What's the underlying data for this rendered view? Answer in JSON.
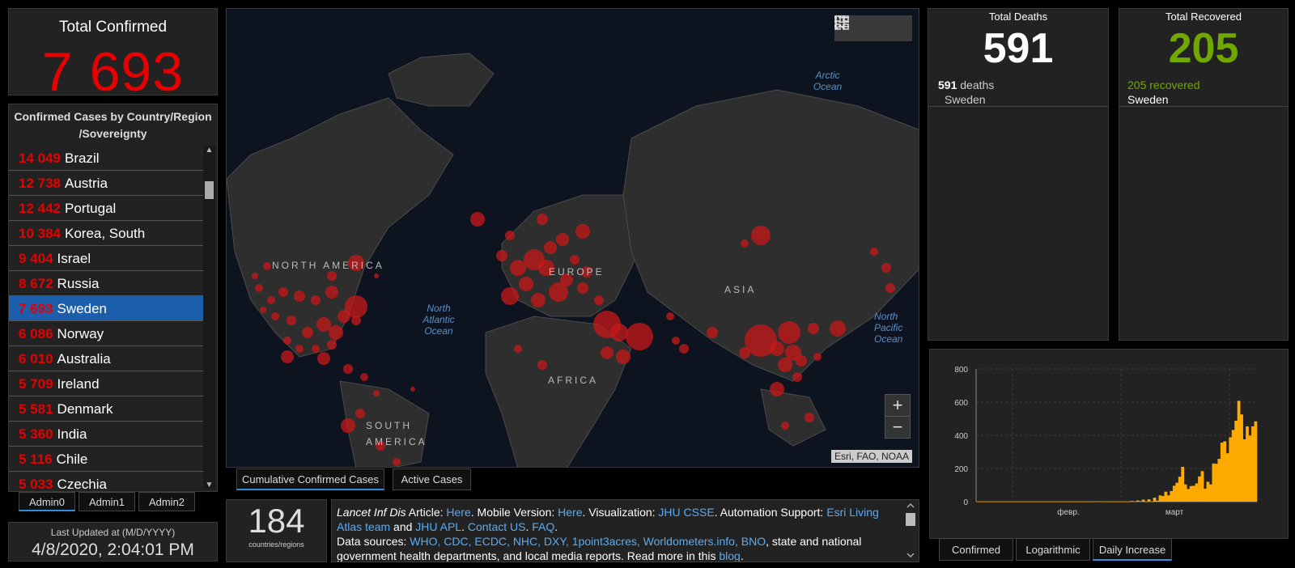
{
  "total_confirmed": {
    "title": "Total Confirmed",
    "value": "7 693"
  },
  "country_list": {
    "header": "Confirmed Cases by Country/Region /Sovereignty",
    "rows": [
      {
        "num": "14 049",
        "name": "Brazil"
      },
      {
        "num": "12 738",
        "name": "Austria"
      },
      {
        "num": "12 442",
        "name": "Portugal"
      },
      {
        "num": "10 384",
        "name": "Korea, South"
      },
      {
        "num": "9 404",
        "name": "Israel"
      },
      {
        "num": "8 672",
        "name": "Russia"
      },
      {
        "num": "7 693",
        "name": "Sweden",
        "selected": true
      },
      {
        "num": "6 086",
        "name": "Norway"
      },
      {
        "num": "6 010",
        "name": "Australia"
      },
      {
        "num": "5 709",
        "name": "Ireland"
      },
      {
        "num": "5 581",
        "name": "Denmark"
      },
      {
        "num": "5 360",
        "name": "India"
      },
      {
        "num": "5 116",
        "name": "Chile"
      },
      {
        "num": "5 033",
        "name": "Czechia"
      }
    ]
  },
  "admin_tabs": [
    "Admin0",
    "Admin1",
    "Admin2"
  ],
  "last_updated": {
    "label": "Last Updated at (M/D/YYYY)",
    "value": "4/8/2020, 2:04:01 PM"
  },
  "map": {
    "labels": {
      "north_america": "NORTH AMERICA",
      "europe": "EUROPE",
      "asia": "ASIA",
      "africa": "AFRICA",
      "south_america": "SOUTH AMERICA",
      "north_atlantic": "North Atlantic Ocean",
      "arctic": "Arctic Ocean",
      "north_pacific": "North Pacific Ocean"
    },
    "attribution": "Esri, FAO, NOAA",
    "zoom_in": "+",
    "zoom_out": "−",
    "tabs": [
      "Cumulative Confirmed Cases",
      "Active Cases"
    ]
  },
  "countries_count": {
    "value": "184",
    "label": "countries/regions"
  },
  "info": {
    "article_journal": "Lancet Inf Dis",
    "article_text": " Article: ",
    "here1": "Here",
    "mobile_text": ". Mobile Version: ",
    "here2": "Here",
    "viz_text": ". Visualization: ",
    "jhu_csse": "JHU CSSE",
    "auto_text": ". Automation Support: ",
    "esri": "Esri Living Atlas team",
    "and_text": " and ",
    "jhu_apl": "JHU APL",
    "dot": ". ",
    "contact": "Contact US",
    "dot2": ". ",
    "faq": "FAQ",
    "dot3": ".",
    "sources_label": "Data sources: ",
    "sources": "WHO, CDC, ECDC, NHC, DXY, 1point3acres, Worldometers.info, BNO",
    "sources_tail": ", state and national government health departments, and local media reports.  Read more in this ",
    "blog": "blog",
    "end": "."
  },
  "deaths": {
    "title": "Total Deaths",
    "value": "591",
    "line_num": "591",
    "line_text": " deaths",
    "country": "Sweden"
  },
  "recovered": {
    "title": "Total Recovered",
    "value": "205",
    "line_num": "205",
    "line_text": " recovered",
    "country": "Sweden"
  },
  "chart_tabs": [
    "Confirmed",
    "Logarithmic",
    "Daily Increase"
  ],
  "colors": {
    "confirmed": "#e60000",
    "recovered": "#70a800",
    "bars": "#ffaa00",
    "selected": "#1b5eab"
  },
  "chart_data": {
    "type": "bar",
    "title": "",
    "xlabel": "",
    "ylabel": "",
    "ylim": [
      0,
      800
    ],
    "yticks": [
      "800",
      "600",
      "400",
      "200",
      "0"
    ],
    "xticks": [
      "февр.",
      "март"
    ],
    "values": [
      0,
      0,
      0,
      0,
      0,
      0,
      0,
      0,
      0,
      0,
      0,
      0,
      0,
      0,
      0,
      0,
      0,
      0,
      0,
      0,
      0,
      0,
      0,
      0,
      0,
      0,
      0,
      0,
      0,
      0,
      0,
      0,
      0,
      0,
      0,
      0,
      0,
      0,
      1,
      0,
      0,
      0,
      0,
      2,
      0,
      1,
      0,
      0,
      0,
      1,
      0,
      0,
      0,
      0,
      0,
      4,
      1,
      7,
      3,
      12,
      0,
      14,
      0,
      24,
      6,
      38,
      34,
      60,
      38,
      64,
      96,
      114,
      150,
      210,
      104,
      76,
      94,
      96,
      110,
      152,
      184,
      78,
      120,
      104,
      230,
      228,
      258,
      356,
      364,
      292,
      388,
      432,
      488,
      608,
      526,
      376,
      454,
      398,
      454,
      484
    ]
  }
}
